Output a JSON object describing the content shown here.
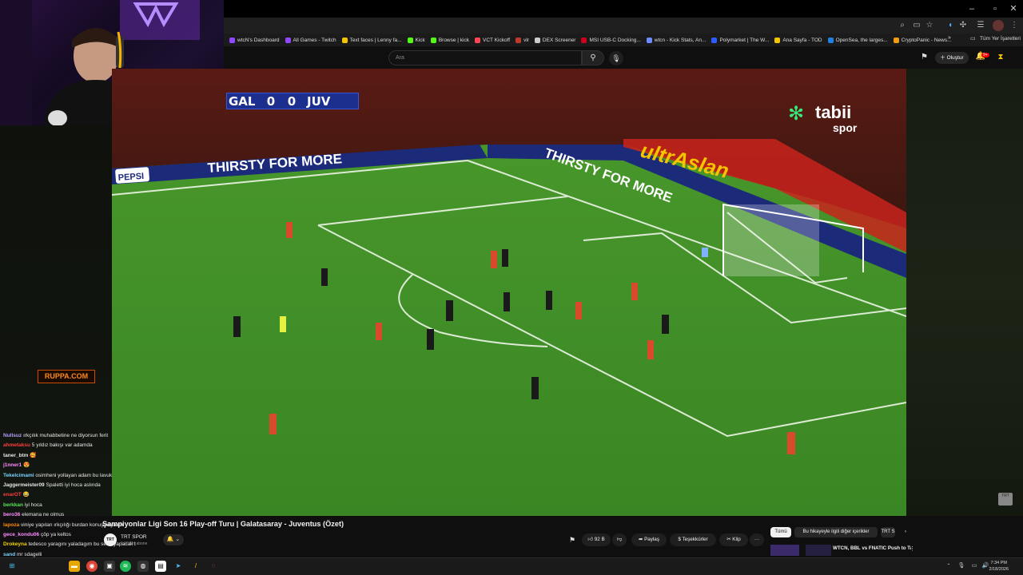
{
  "browser": {
    "window_controls": [
      "–",
      "▫",
      "✕"
    ],
    "bookmarks": [
      {
        "label": "wtcN's Dashboard",
        "color": "#9146ff"
      },
      {
        "label": "All Games - Twitch",
        "color": "#9146ff"
      },
      {
        "label": "Text faces | Lenny fa...",
        "color": "#f5c400"
      },
      {
        "label": "Kick",
        "color": "#53fc18"
      },
      {
        "label": "Browse | kick",
        "color": "#53fc18"
      },
      {
        "label": "VCT Kickoff",
        "color": "#ff4655"
      },
      {
        "label": "vlr",
        "color": "#c0392b"
      },
      {
        "label": "DEX Screener",
        "color": "#cccccc"
      },
      {
        "label": "MSI USB-C Docking...",
        "color": "#d0021b"
      },
      {
        "label": "wtcn - Kick Stats, An...",
        "color": "#6c8bff"
      },
      {
        "label": "Polymarket | The W...",
        "color": "#2d5bff"
      },
      {
        "label": "Ana Sayfa - TOD",
        "color": "#f5c400"
      },
      {
        "label": "OpenSea, the larges...",
        "color": "#2081e2"
      },
      {
        "label": "CryptoPanic - News...",
        "color": "#f39c12"
      }
    ],
    "all_bookmarks": "Tüm Yer İşaretleri"
  },
  "youtube": {
    "search_placeholder": "Ara",
    "create_label": "Oluştur",
    "notification_count": "9+"
  },
  "scoreboard": {
    "home": "GAL",
    "home_score": "0",
    "away_score": "0",
    "away": "JUV"
  },
  "broadcaster_logo": {
    "line1": "tabii",
    "line2": "spor"
  },
  "watermark": "TRT",
  "stadium_ads": {
    "pepsi": "PEPSI",
    "slogan": "THIRSTY FOR MORE",
    "ultraslan": "ultrAslan"
  },
  "video": {
    "title": "Şampiyonlar Ligi Son 16 Play-off Turu | Galatasaray - Juventus (Özet)",
    "channel": "TRT SPOR",
    "channel_avatar": "TRT",
    "subscribers": "1,06 Mn abone",
    "likes": "92 B",
    "share": "Paylaş",
    "thanks": "Teşekkürler",
    "clip": "Klip",
    "more": "···"
  },
  "chips": [
    "Tümü",
    "Bu hikayeyle ilgili diğer içerikler",
    "TRT S"
  ],
  "reco_title": "WTCN, BBL vs FNATIC Push to Talk İzliyor",
  "chat": [
    {
      "user": "",
      "color": "#b59dff",
      "msg": ""
    },
    {
      "user": "Nullsuz",
      "color": "#b59dff",
      "msg": "ırkçılık muhabbetine ne diyorsun ferit"
    },
    {
      "user": "ahmetaksu",
      "color": "#ff3d3d",
      "msg": "5 yıldız bakışı var adamda"
    },
    {
      "user": "taner_btm",
      "color": "#e6e6e6",
      "msg": "🥰"
    },
    {
      "user": "j1nner1",
      "color": "#ff8cff",
      "msg": "😍"
    },
    {
      "user": "Tekelcimami",
      "color": "#7cd2ff",
      "msg": "osimheni yollayan adam bu lavuk"
    },
    {
      "user": "Jaggermeister09",
      "color": "#e6e6e6",
      "msg": "Spaletti iyi hoca aslında"
    },
    {
      "user": "enarOT",
      "color": "#ff3d3d",
      "msg": "😂"
    },
    {
      "user": "berkkan",
      "color": "#56e456",
      "msg": "iyi hoca"
    },
    {
      "user": "bero36",
      "color": "#ff8cff",
      "msg": "elemana ne olmus"
    },
    {
      "user": "lapoza",
      "color": "#ff8c00",
      "msg": "viniye yapılan ırkçılığı burdan konuşmayalım"
    },
    {
      "user": "gece_kondu06",
      "color": "#ff8cff",
      "msg": "çöp ya keltos"
    },
    {
      "user": "Drokeyna",
      "color": "#f5d300",
      "msg": "tedesco yaragını yaladagım bu sene yapacak bizi @WtcN"
    },
    {
      "user": "sand",
      "color": "#7cd2ff",
      "msg": "mr sdagelli"
    }
  ],
  "chat_overlay_logo": "RUPPA.COM",
  "taskbar": {
    "time": "7:34 PM",
    "date": "2/18/2026"
  }
}
